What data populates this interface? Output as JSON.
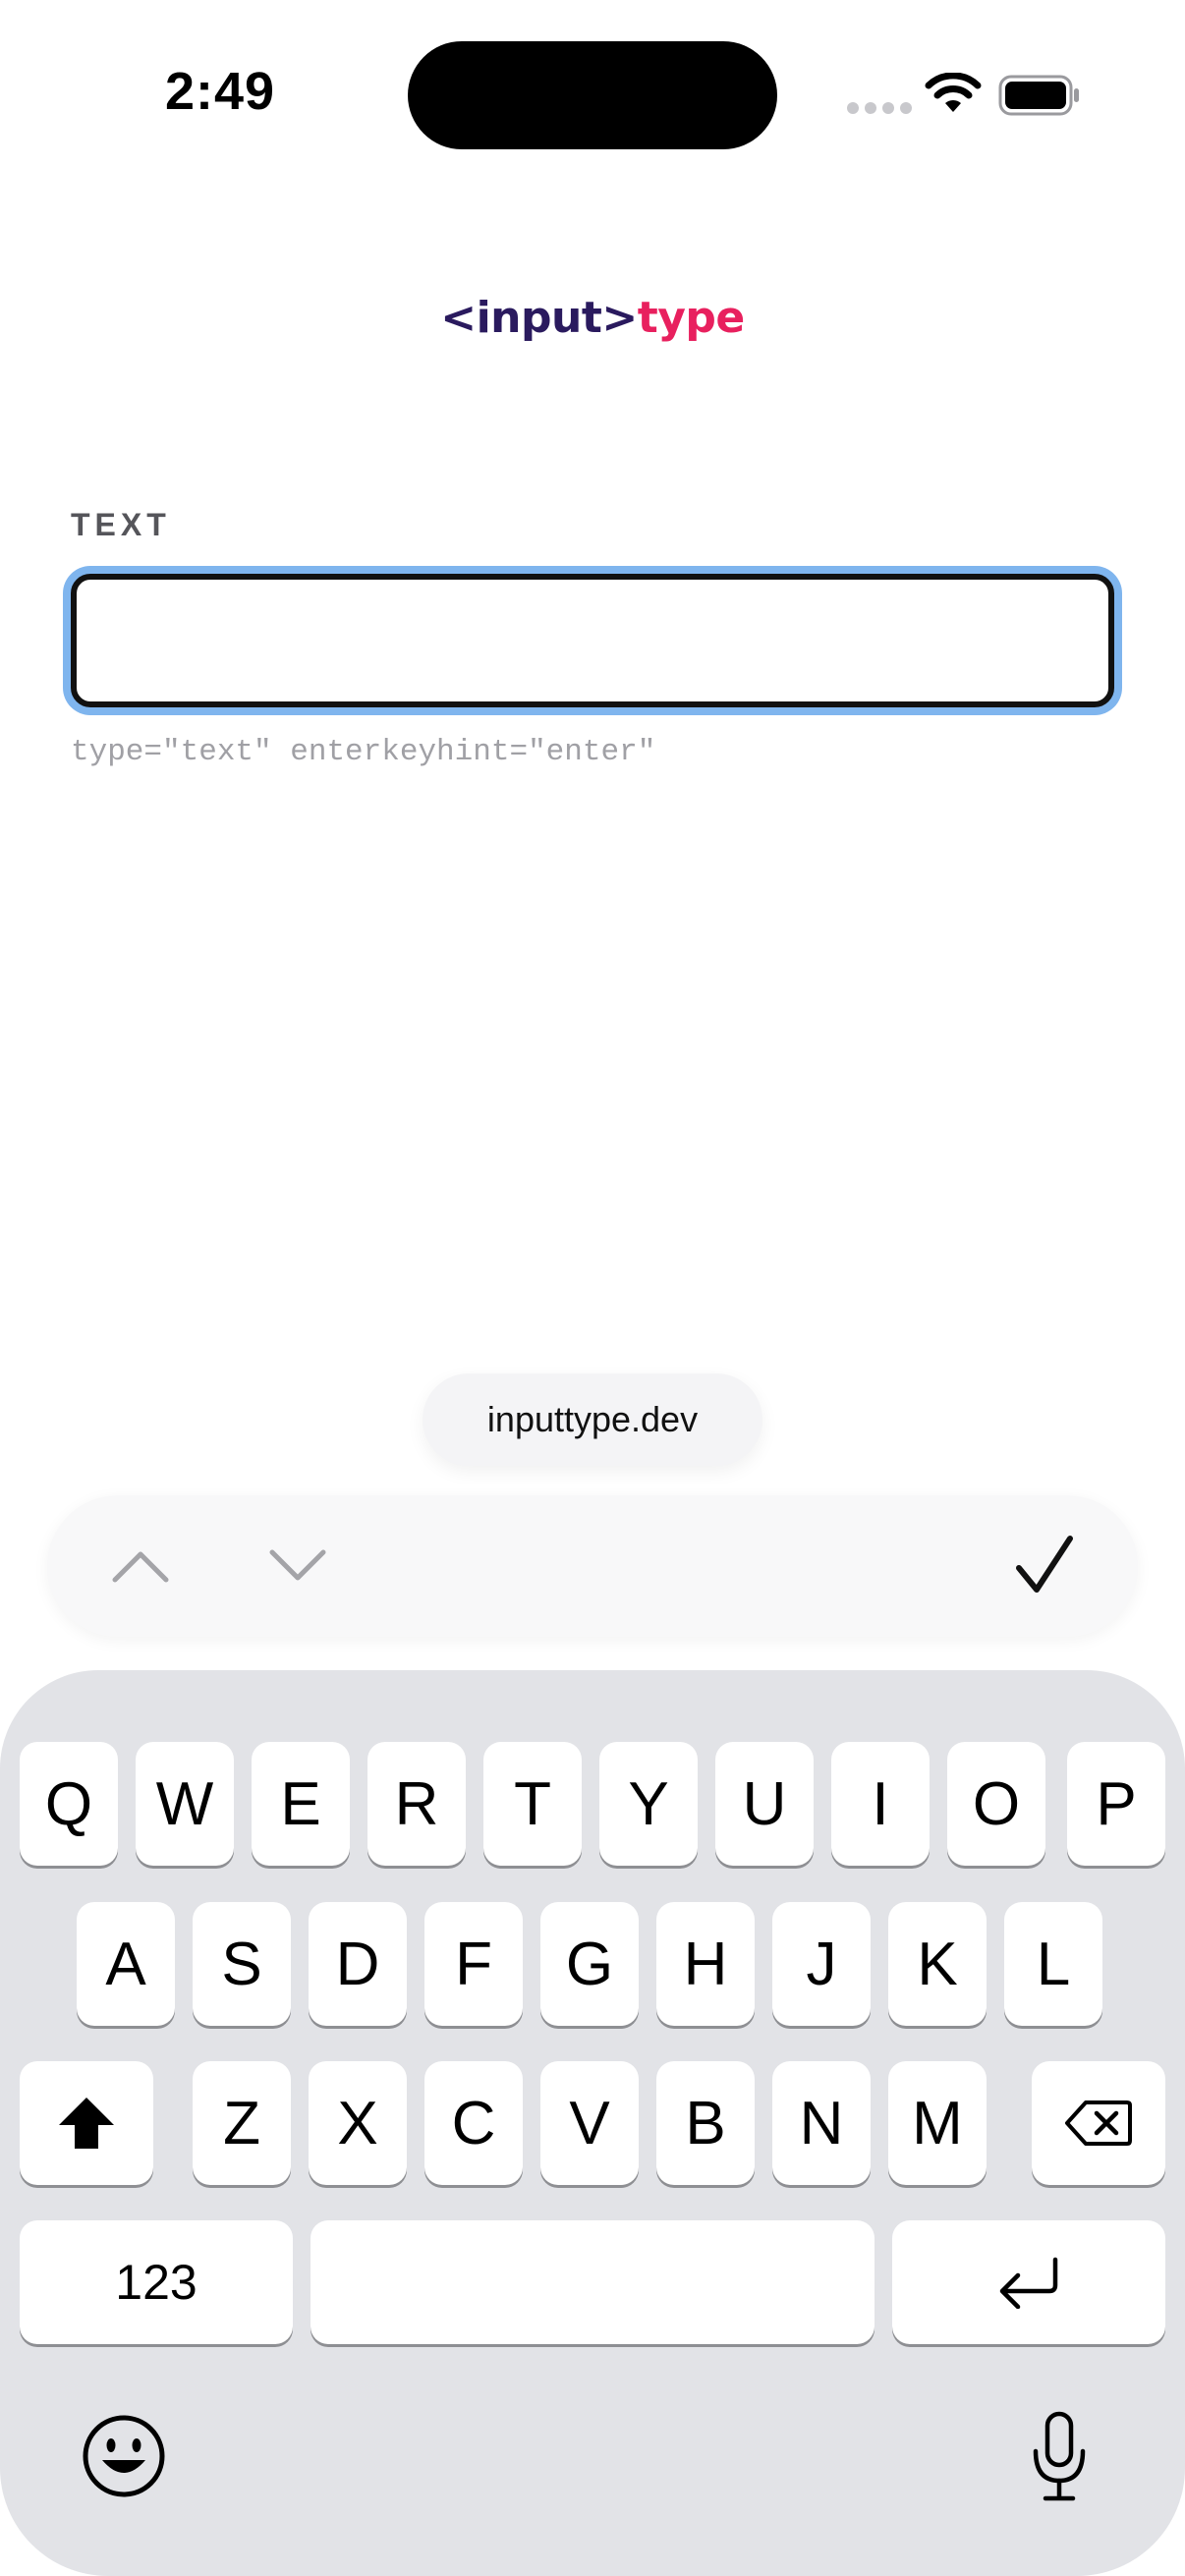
{
  "status_bar": {
    "time": "2:49",
    "icons": [
      "cellular-signal-icon",
      "wifi-icon",
      "battery-icon"
    ]
  },
  "logo": {
    "tag": "<input>",
    "word": "type"
  },
  "field": {
    "label": "TEXT",
    "value": "",
    "placeholder": "",
    "hint": "type=\"text\" enterkeyhint=\"enter\"",
    "focus_ring_color": "#7fb5ee"
  },
  "suggestion": {
    "label": "inputtype.dev"
  },
  "accessory_bar": {
    "icons": [
      "chevron-up-icon",
      "chevron-down-icon",
      "checkmark-icon"
    ]
  },
  "keyboard": {
    "row1": [
      "Q",
      "W",
      "E",
      "R",
      "T",
      "Y",
      "U",
      "I",
      "O",
      "P"
    ],
    "row2": [
      "A",
      "S",
      "D",
      "F",
      "G",
      "H",
      "J",
      "K",
      "L"
    ],
    "row3": [
      "Z",
      "X",
      "C",
      "V",
      "B",
      "N",
      "M"
    ],
    "numbers_label": "123",
    "space_label": "",
    "icons": [
      "shift-icon",
      "backspace-icon",
      "return-icon",
      "emoji-icon",
      "microphone-icon"
    ]
  },
  "colors": {
    "logo_tag": "#2a1a5e",
    "logo_word": "#e8205e",
    "keyboard_bg": "#e2e3e7"
  }
}
